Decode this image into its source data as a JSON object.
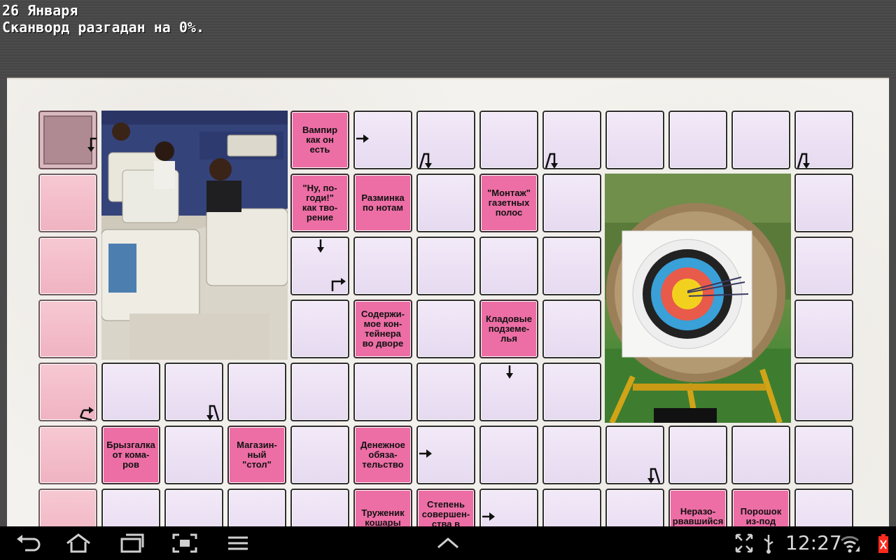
{
  "header": {
    "date": "26 Января",
    "progress_text": "Сканворд разгадан на 0%."
  },
  "puzzle": {
    "clues": [
      {
        "id": "c1",
        "text": "Вампир\nкак он\nесть"
      },
      {
        "id": "c2",
        "text": "\"Ну, по-\nгоди!\"\nкак тво-\nрение"
      },
      {
        "id": "c3",
        "text": "Разминка\nпо нотам"
      },
      {
        "id": "c4",
        "text": "\"Монтаж\"\nгазетных\nполос"
      },
      {
        "id": "c5",
        "text": "Содержи-\nмое кон-\nтейнера\nво дворе"
      },
      {
        "id": "c6",
        "text": "Кладовые\nподземе-\nлья"
      },
      {
        "id": "c7",
        "text": "Брызгалка\nот кома-\nров"
      },
      {
        "id": "c8",
        "text": "Магазин-\nный\n\"стол\""
      },
      {
        "id": "c9",
        "text": "Денежное\nобяза-\nтельство"
      },
      {
        "id": "c10",
        "text": "Труженик\nкошары"
      },
      {
        "id": "c11",
        "text": "Степень\nсовершен-\nства в"
      },
      {
        "id": "c12",
        "text": "Неразо-\nрвавшийся"
      },
      {
        "id": "c13",
        "text": "Порошок\nиз-под"
      }
    ],
    "images": [
      {
        "name": "computer-class-photo"
      },
      {
        "name": "archery-target-photo"
      }
    ]
  },
  "statusbar": {
    "time": "12:27",
    "icons": [
      "back-icon",
      "home-icon",
      "recent-apps-icon",
      "screenshot-icon",
      "menu-icon",
      "up-chevron-icon",
      "fullscreen-icon",
      "usb-icon",
      "wifi-icon",
      "battery-icon"
    ]
  },
  "colors": {
    "clue": "#ec6ea5",
    "letter_cell": "#efe4f6",
    "side_cell": "#f6c8d2",
    "paper": "#f4f2ee",
    "header_bg": "#4a4a4a"
  }
}
